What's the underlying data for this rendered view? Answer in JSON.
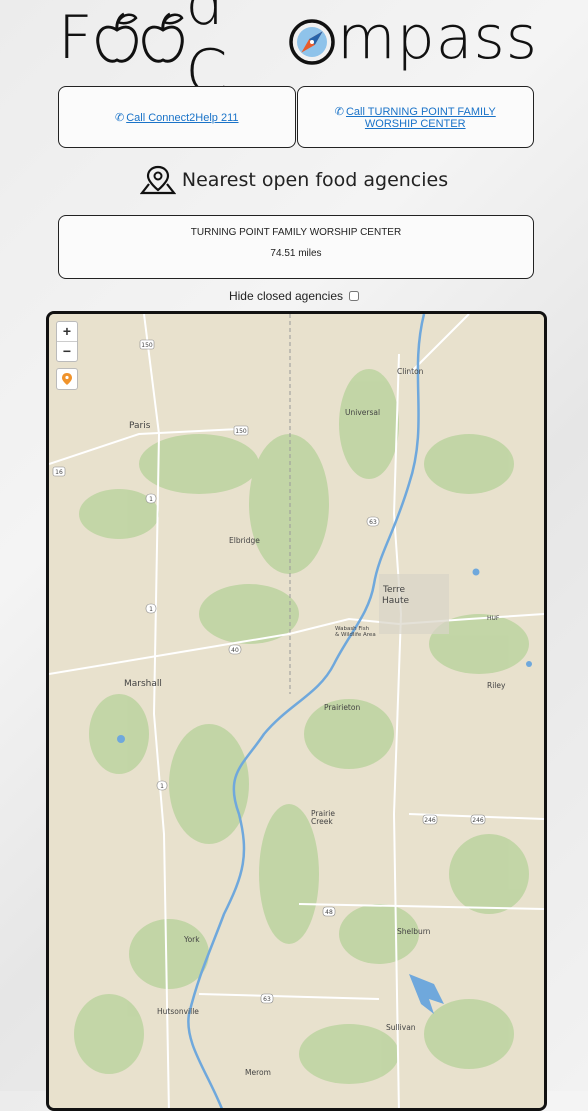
{
  "logo": {
    "part1": "F",
    "part2": "d C",
    "part3": "mpass"
  },
  "buttons": {
    "call_211": "Call Connect2Help 211",
    "call_agency": "Call TURNING POINT FAMILY WORSHIP CENTER"
  },
  "heading": "Nearest open food agencies",
  "agency": {
    "name": "TURNING POINT FAMILY WORSHIP CENTER",
    "distance": "74.51 miles"
  },
  "filter": {
    "label": "Hide closed agencies",
    "checked": false
  },
  "map": {
    "zoom_in": "+",
    "zoom_out": "−",
    "places": {
      "clinton": "Clinton",
      "universal": "Universal",
      "paris": "Paris",
      "elbridge": "Elbridge",
      "terre": "Terre",
      "haute": "Haute",
      "wabash1": "Wabash Fish",
      "wabash2": "& Wildlife Area",
      "huf": "HUF",
      "marshall": "Marshall",
      "riley": "Riley",
      "prairieton": "Prairieton",
      "prairie": "Prairie",
      "creek": "Creek",
      "shelburn": "Shelburn",
      "york": "York",
      "hutsonville": "Hutsonville",
      "sullivan": "Sullivan",
      "merom": "Merom"
    },
    "shields": {
      "s150a": "150",
      "s150b": "150",
      "s16": "16",
      "s1a": "1",
      "s1b": "1",
      "s63": "63",
      "s40": "40",
      "s1c": "1",
      "s246a": "246",
      "s246b": "246",
      "s48": "48",
      "s63b": "63"
    }
  },
  "colors": {
    "link": "#1a73c8",
    "map_land": "#e8e1cd",
    "map_green": "#bcd3a0",
    "water": "#6fa8dc"
  }
}
